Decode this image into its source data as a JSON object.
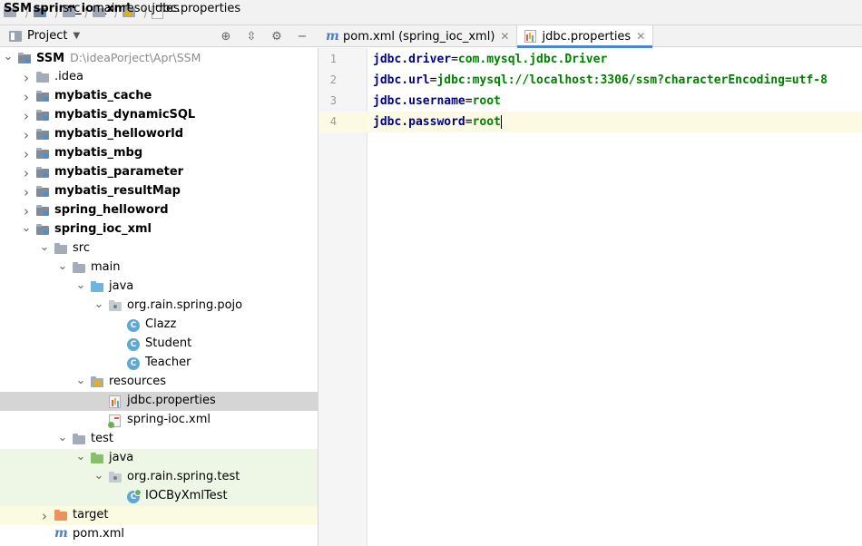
{
  "breadcrumb": [
    {
      "label": "SSM",
      "bold": true,
      "icon": "folder-icon"
    },
    {
      "label": "spring_ioc_xml",
      "bold": true,
      "icon": "module-folder-icon"
    },
    {
      "label": "src",
      "bold": false,
      "icon": "folder-icon"
    },
    {
      "label": "main",
      "bold": false,
      "icon": "folder-icon"
    },
    {
      "label": "resources",
      "bold": false,
      "icon": "resources-folder-icon"
    },
    {
      "label": "jdbc.properties",
      "bold": false,
      "icon": "properties-file-icon"
    }
  ],
  "project_panel": {
    "title": "Project",
    "tools": [
      "locate-icon",
      "collapse-icon",
      "gear-icon",
      "hide-icon"
    ]
  },
  "tree": [
    {
      "label": "SSM",
      "path": "D:\\ideaPorject\\Apr\\SSM",
      "bold": true,
      "indent": 0,
      "arrow": "down",
      "icon": "module"
    },
    {
      "label": ".idea",
      "bold": false,
      "indent": 1,
      "arrow": "right",
      "icon": "folder"
    },
    {
      "label": "mybatis_cache",
      "bold": true,
      "indent": 1,
      "arrow": "right",
      "icon": "module"
    },
    {
      "label": "mybatis_dynamicSQL",
      "bold": true,
      "indent": 1,
      "arrow": "right",
      "icon": "module"
    },
    {
      "label": "mybatis_helloworld",
      "bold": true,
      "indent": 1,
      "arrow": "right",
      "icon": "module"
    },
    {
      "label": "mybatis_mbg",
      "bold": true,
      "indent": 1,
      "arrow": "right",
      "icon": "module"
    },
    {
      "label": "mybatis_parameter",
      "bold": true,
      "indent": 1,
      "arrow": "right",
      "icon": "module"
    },
    {
      "label": "mybatis_resultMap",
      "bold": true,
      "indent": 1,
      "arrow": "right",
      "icon": "module"
    },
    {
      "label": "spring_helloword",
      "bold": true,
      "indent": 1,
      "arrow": "right",
      "icon": "module"
    },
    {
      "label": "spring_ioc_xml",
      "bold": true,
      "indent": 1,
      "arrow": "down",
      "icon": "module"
    },
    {
      "label": "src",
      "bold": false,
      "indent": 2,
      "arrow": "down",
      "icon": "folder"
    },
    {
      "label": "main",
      "bold": false,
      "indent": 3,
      "arrow": "down",
      "icon": "folder"
    },
    {
      "label": "java",
      "bold": false,
      "indent": 4,
      "arrow": "down",
      "icon": "java"
    },
    {
      "label": "org.rain.spring.pojo",
      "bold": false,
      "indent": 5,
      "arrow": "down",
      "icon": "pkg"
    },
    {
      "label": "Clazz",
      "bold": false,
      "indent": 6,
      "arrow": "",
      "icon": "class"
    },
    {
      "label": "Student",
      "bold": false,
      "indent": 6,
      "arrow": "",
      "icon": "class"
    },
    {
      "label": "Teacher",
      "bold": false,
      "indent": 6,
      "arrow": "",
      "icon": "class"
    },
    {
      "label": "resources",
      "bold": false,
      "indent": 4,
      "arrow": "down",
      "icon": "res"
    },
    {
      "label": "jdbc.properties",
      "bold": false,
      "indent": 5,
      "arrow": "",
      "icon": "props",
      "selected": true
    },
    {
      "label": "spring-ioc.xml",
      "bold": false,
      "indent": 5,
      "arrow": "",
      "icon": "springxml"
    },
    {
      "label": "test",
      "bold": false,
      "indent": 3,
      "arrow": "down",
      "icon": "folder"
    },
    {
      "label": "java",
      "bold": false,
      "indent": 4,
      "arrow": "down",
      "icon": "javatest",
      "bg": "test"
    },
    {
      "label": "org.rain.spring.test",
      "bold": false,
      "indent": 5,
      "arrow": "down",
      "icon": "pkg",
      "bg": "test"
    },
    {
      "label": "IOCByXmlTest",
      "bold": false,
      "indent": 6,
      "arrow": "",
      "icon": "testclass",
      "bg": "test"
    },
    {
      "label": "target",
      "bold": false,
      "indent": 2,
      "arrow": "right",
      "icon": "target",
      "bg": "target"
    },
    {
      "label": "pom.xml",
      "bold": false,
      "indent": 2,
      "arrow": "",
      "icon": "maven"
    }
  ],
  "tabs": [
    {
      "label": "pom.xml (spring_ioc_xml)",
      "icon": "maven-icon",
      "active": false
    },
    {
      "label": "jdbc.properties",
      "icon": "properties-file-icon",
      "active": true
    }
  ],
  "editor": {
    "lines": [
      {
        "num": "1",
        "key": "jdbc.driver",
        "eq": "=",
        "value": "com.mysql.jdbc.Driver"
      },
      {
        "num": "2",
        "key": "jdbc.url",
        "eq": "=",
        "value": "jdbc:mysql://localhost:3306/ssm?characterEncoding=utf-8"
      },
      {
        "num": "3",
        "key": "jdbc.username",
        "eq": "=",
        "value": "root"
      },
      {
        "num": "4",
        "key": "jdbc.password",
        "eq": "=",
        "value": "root",
        "current": true
      }
    ]
  }
}
